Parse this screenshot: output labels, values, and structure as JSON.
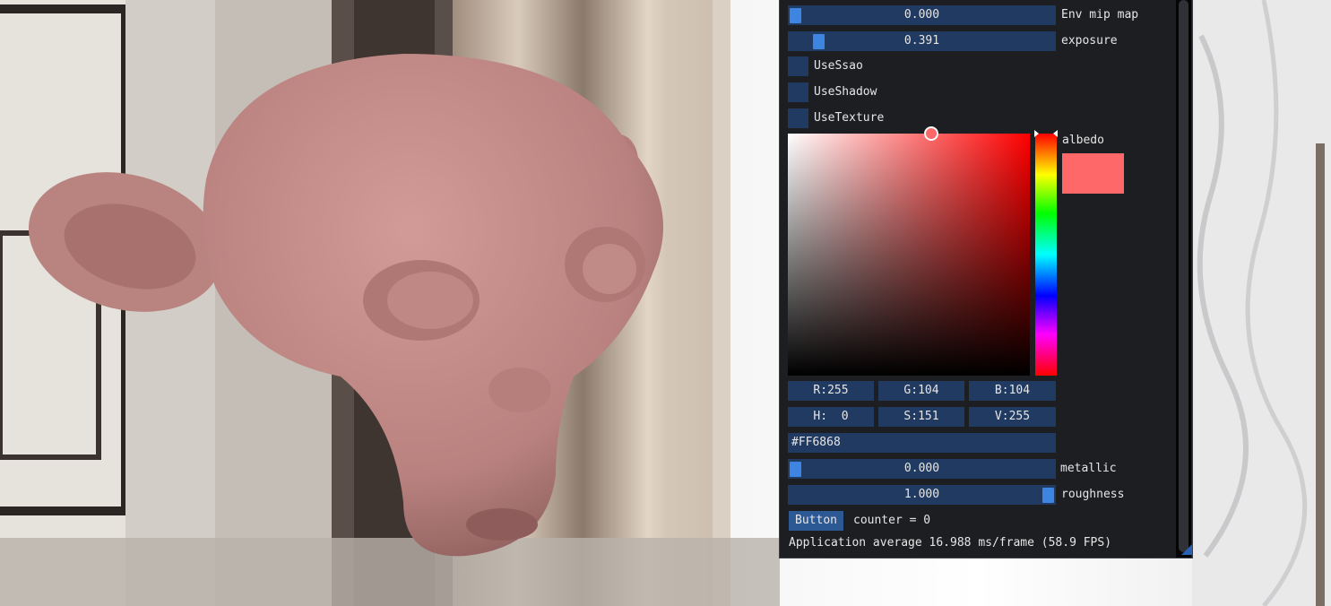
{
  "panel": {
    "env_mip_map": {
      "label": "Env mip map",
      "value": "0.000",
      "fraction": 0.0
    },
    "exposure": {
      "label": "exposure",
      "value": "0.391",
      "fraction": 0.0913
    },
    "checkboxes": [
      {
        "label": "UseSsao",
        "checked": false
      },
      {
        "label": "UseShadow",
        "checked": false
      },
      {
        "label": "UseTexture",
        "checked": false
      }
    ],
    "albedo": {
      "label": "albedo",
      "color": "#FF6868",
      "hex_field": "#FF6868",
      "r": "R:255",
      "g": "G:104",
      "b": "B:104",
      "h": "H:  0",
      "s": "S:151",
      "v": "V:255",
      "saturation": 0.592,
      "brightness": 1.0,
      "hue": 0.0
    },
    "metallic": {
      "label": "metallic",
      "value": "0.000",
      "fraction": 0.0
    },
    "roughness": {
      "label": "roughness",
      "value": "1.000",
      "fraction": 1.0
    },
    "button": {
      "label": "Button"
    },
    "counter": "counter = 0",
    "fps_text": "Application average 16.988 ms/frame (58.9 FPS)"
  },
  "colors": {
    "frame_bg": "#203a61",
    "slider_grab": "#3d85e0",
    "button_bg": "#2c5894",
    "window_bg": "#0f1014",
    "model_tint": "#c98a87"
  }
}
